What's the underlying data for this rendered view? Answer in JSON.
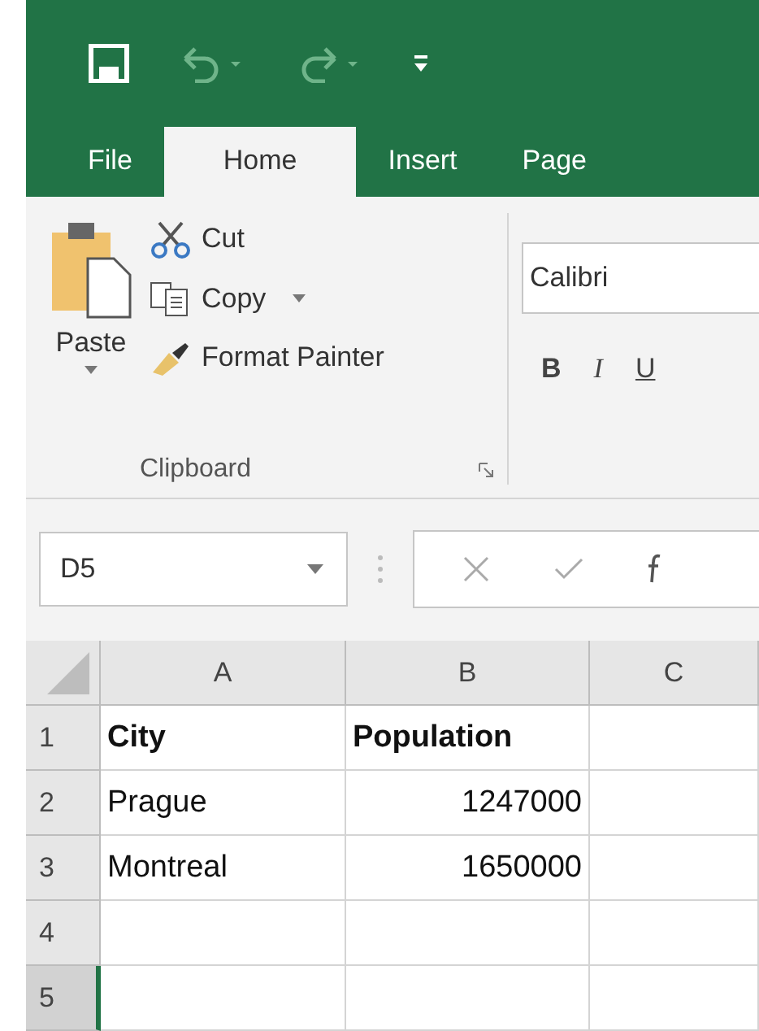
{
  "quick_access": {
    "tools": [
      {
        "kind": "save"
      },
      {
        "kind": "undo"
      },
      {
        "kind": "redo"
      },
      {
        "kind": "customize"
      }
    ]
  },
  "tabs": [
    {
      "label": "File",
      "selected": false
    },
    {
      "label": "Home",
      "selected": true
    },
    {
      "label": "Insert",
      "selected": false
    },
    {
      "label": "Page",
      "selected": false
    }
  ],
  "clipboard": {
    "paste": "Paste",
    "cut": "Cut",
    "copy": "Copy",
    "format_painter": "Format Painter",
    "group_label": "Clipboard"
  },
  "font": {
    "name": "Calibri",
    "styles": [
      {
        "label": "B",
        "kind": "bold"
      },
      {
        "label": "I",
        "kind": "italic"
      },
      {
        "label": "U",
        "kind": "underline"
      }
    ]
  },
  "name_box": "D5",
  "columns": [
    "A",
    "B",
    "C"
  ],
  "rows": [
    {
      "header": "1",
      "selected": false,
      "cells": [
        {
          "text": "City",
          "bold": true,
          "kind": "text"
        },
        {
          "text": "Population",
          "bold": true,
          "kind": "text"
        }
      ]
    },
    {
      "header": "2",
      "selected": false,
      "cells": [
        {
          "text": "Prague",
          "bold": false,
          "kind": "text"
        },
        {
          "text": "1247000",
          "bold": false,
          "kind": "number"
        }
      ]
    },
    {
      "header": "3",
      "selected": false,
      "cells": [
        {
          "text": "Montreal",
          "bold": false,
          "kind": "text"
        },
        {
          "text": "1650000",
          "bold": false,
          "kind": "number"
        }
      ]
    },
    {
      "header": "4",
      "selected": false,
      "cells": []
    },
    {
      "header": "5",
      "selected": true,
      "cells": []
    }
  ]
}
